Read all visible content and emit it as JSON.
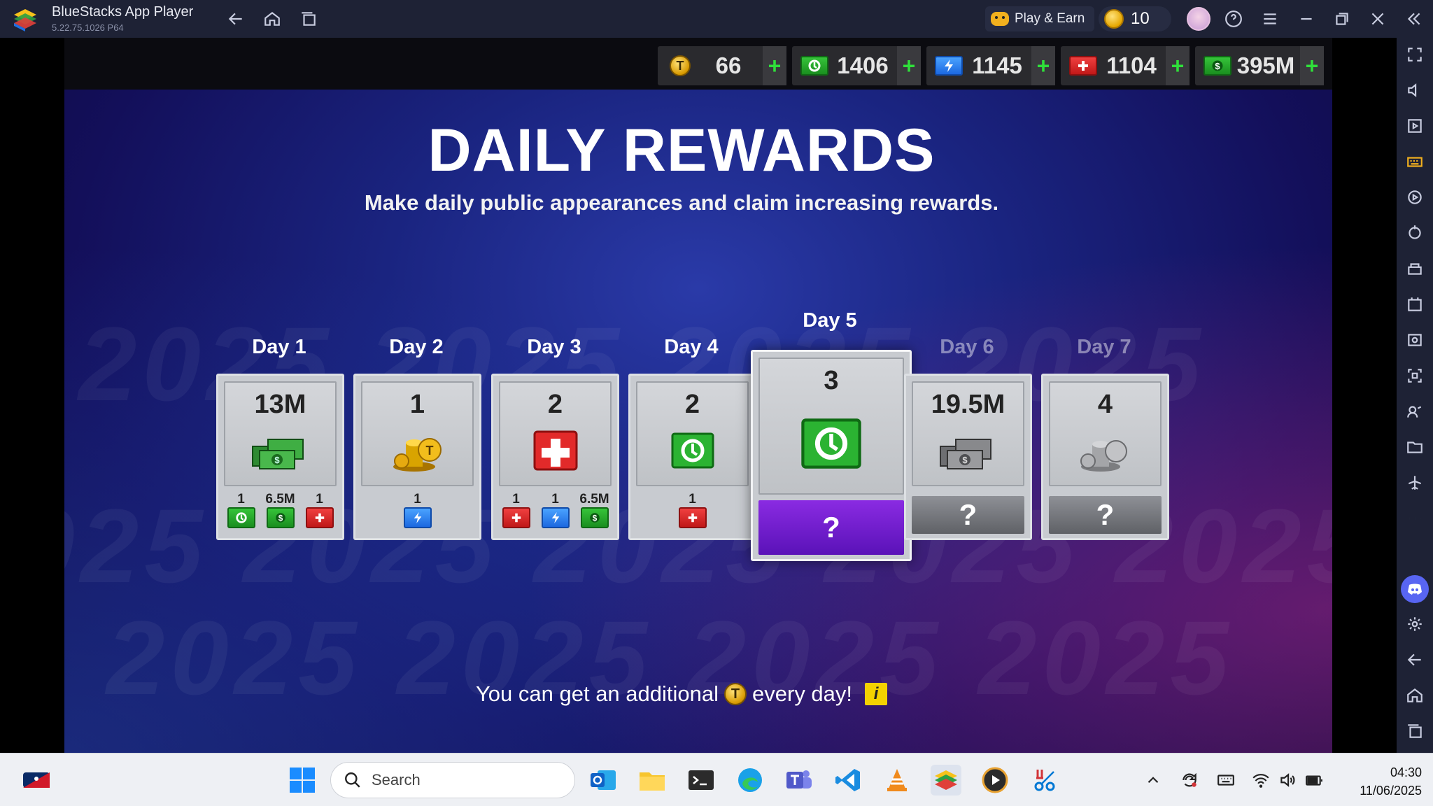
{
  "window": {
    "title": "BlueStacks App Player",
    "version": "5.22.75.1026  P64",
    "play_earn_label": "Play & Earn",
    "coin_count": "10"
  },
  "resources": [
    {
      "name": "t-coin",
      "value": "66"
    },
    {
      "name": "cash-badge",
      "value": "1406"
    },
    {
      "name": "energy",
      "value": "1145"
    },
    {
      "name": "medical",
      "value": "1104"
    },
    {
      "name": "money",
      "value": "395M"
    }
  ],
  "resource_plus_label": "+",
  "rewards": {
    "title": "DAILY REWARDS",
    "subtitle": "Make daily public appearances and claim increasing rewards.",
    "days": [
      {
        "label": "Day 1",
        "amount": "13M",
        "icon": "cash-stack-icon",
        "bonus": [
          {
            "value": "1",
            "icon": "green-badge-icon"
          },
          {
            "value": "6.5M",
            "icon": "money-icon"
          },
          {
            "value": "1",
            "icon": "medical-icon"
          }
        ]
      },
      {
        "label": "Day 2",
        "amount": "1",
        "icon": "gold-coins-icon",
        "bonus": [
          {
            "value": "1",
            "icon": "energy-icon"
          }
        ]
      },
      {
        "label": "Day 3",
        "amount": "2",
        "icon": "medkit-icon",
        "bonus": [
          {
            "value": "1",
            "icon": "medical-icon"
          },
          {
            "value": "1",
            "icon": "energy-icon"
          },
          {
            "value": "6.5M",
            "icon": "money-icon"
          }
        ]
      },
      {
        "label": "Day 4",
        "amount": "2",
        "icon": "green-badge-icon",
        "bonus": [
          {
            "value": "1",
            "icon": "medical-icon"
          }
        ]
      },
      {
        "label": "Day 5",
        "amount": "3",
        "icon": "green-badge-icon",
        "mystery": "?"
      },
      {
        "label": "Day 6",
        "amount": "19.5M",
        "icon": "cash-stack-icon",
        "mystery": "?"
      },
      {
        "label": "Day 7",
        "amount": "4",
        "icon": "silver-coins-icon",
        "mystery": "?"
      }
    ],
    "footer_before": "You can get an additional",
    "footer_after": "every day!",
    "footer_coin": "T",
    "info_label": "i"
  },
  "taskbar": {
    "search_placeholder": "Search",
    "time": "04:30",
    "date": "11/06/2025"
  },
  "colors": {
    "titlebar": "#1e2235",
    "game_bg": "#1a2480",
    "plus_green": "#2fe03a",
    "mystery_purple": "#7b1fd6"
  }
}
